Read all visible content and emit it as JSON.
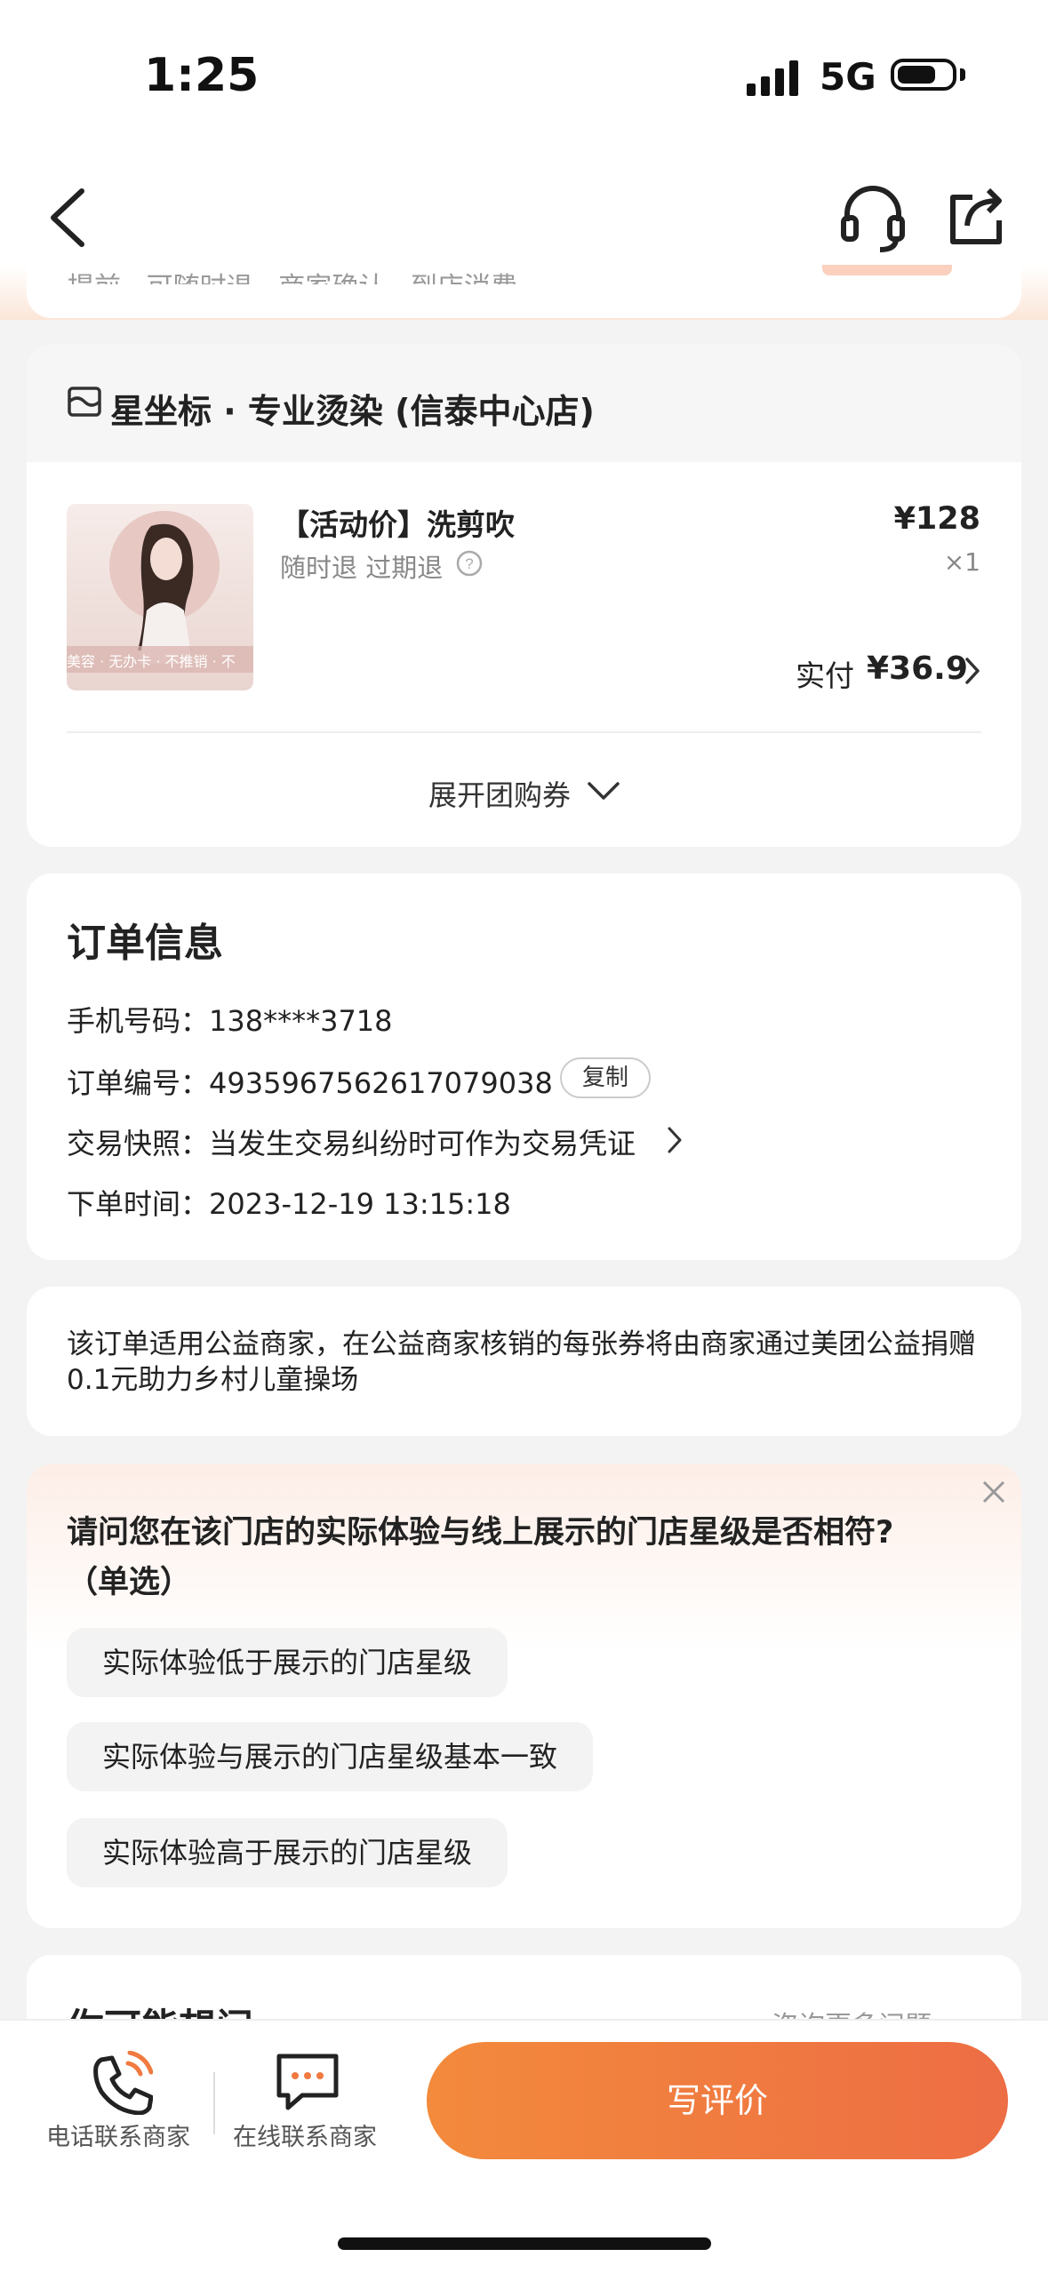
{
  "status_bar": {
    "time": "1:25",
    "network": "5G"
  },
  "top_card": {
    "peek_text": "提前 · 可随时退 · 商家确认 · 到店消费"
  },
  "store": {
    "name": "星坐标 · 专业烫染 (信泰中心店)",
    "product": {
      "title": "【活动价】洗剪吹",
      "refund": "随时退 过期退",
      "price": "¥128",
      "qty": "×1",
      "paid_label": "实付",
      "paid_amount": "¥36.9",
      "image_text": "美容 · 无办卡 · 不推销 · 不"
    },
    "expand_label": "展开团购券"
  },
  "order_info": {
    "title": "订单信息",
    "phone": "手机号码：138****3718",
    "order_no": "订单编号：4935967562617079038",
    "copy_label": "复制",
    "snapshot": "交易快照：当发生交易纠纷时可作为交易凭证",
    "time": "下单时间：2023-12-19 13:15:18"
  },
  "charity": {
    "text": "该订单适用公益商家，在公益商家核销的每张券将由商家通过美团公益捐赠 0.1元助力乡村儿童操场"
  },
  "survey": {
    "question": "请问您在该门店的实际体验与线上展示的门店星级是否相符?（单选）",
    "options": [
      "实际体验低于展示的门店星级",
      "实际体验与展示的门店星级基本一致",
      "实际体验高于展示的门店星级"
    ]
  },
  "may_ask": {
    "title": "你可能想问",
    "more": "咨询更多问题"
  },
  "bottom_bar": {
    "phone_label": "电话联系商家",
    "online_label": "在线联系商家",
    "write_review": "写评价"
  },
  "colors": {
    "accent": "#f07a40",
    "background": "#f3f3f3"
  }
}
